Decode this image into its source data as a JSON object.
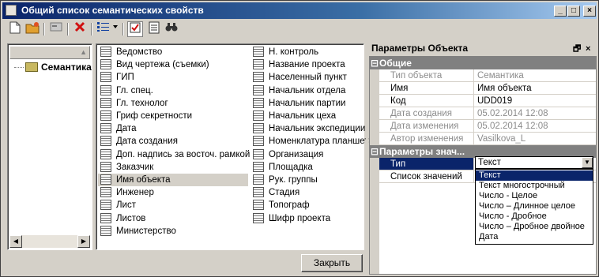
{
  "window": {
    "title": "Общий список семантических свойств"
  },
  "titlebar_buttons": {
    "minimize": "_",
    "maximize": "□",
    "close": "×"
  },
  "tree": {
    "root_label": "Семантика"
  },
  "list": {
    "col1": [
      "Ведомство",
      "Вид чертежа (съемки)",
      "ГИП",
      "Гл. спец.",
      "Гл. технолог",
      "Гриф секретности",
      "Дата",
      "Дата создания",
      "Доп. надпись за восточ. рамкой",
      "Заказчик",
      "Имя объекта",
      "Инженер",
      "Лист",
      "Листов",
      "Министерство"
    ],
    "col2": [
      "Н. контроль",
      "Название проекта",
      "Населенный пункт",
      "Начальник отдела",
      "Начальник партии",
      "Начальник цеха",
      "Начальник экспедиции",
      "Номенклатура планшета",
      "Организация",
      "Площадка",
      "Рук. группы",
      "Стадия",
      "Топограф",
      "Шифр проекта"
    ],
    "selected": "Имя объекта"
  },
  "close_button": "Закрыть",
  "panel": {
    "title": "Параметры Объекта",
    "pin_glyph": "🗗",
    "close_glyph": "×",
    "category_general": "Общие",
    "category_params": "Параметры знач...",
    "general": [
      {
        "name": "Тип объекта",
        "value": "Семантика",
        "readonly": true
      },
      {
        "name": "Имя",
        "value": "Имя объекта",
        "readonly": false
      },
      {
        "name": "Код",
        "value": "UDD019",
        "readonly": false
      },
      {
        "name": "Дата создания",
        "value": "05.02.2014 12:08",
        "readonly": true
      },
      {
        "name": "Дата изменения",
        "value": "05.02.2014 12:08",
        "readonly": true
      },
      {
        "name": "Автор изменения",
        "value": "Vasilkova_L",
        "readonly": true
      }
    ],
    "params": [
      {
        "name": "Тип",
        "value": "Текст"
      },
      {
        "name": "Список значений",
        "value": ""
      }
    ],
    "type_options": [
      "Текст",
      "Текст многострочный",
      "Число - Целое",
      "Число – Длинное целое",
      "Число - Дробное",
      "Число – Дробное двойное",
      "Дата"
    ],
    "type_selected": "Текст"
  },
  "colors": {
    "title_start": "#0a246a",
    "title_end": "#a6caf0",
    "selection": "#0a246a",
    "category": "#808080"
  },
  "icons": [
    "new-document-icon",
    "open-folder-icon",
    "properties-icon",
    "delete-icon",
    "view-list-icon",
    "checkbox-icon",
    "document-list-icon",
    "find-icon"
  ]
}
